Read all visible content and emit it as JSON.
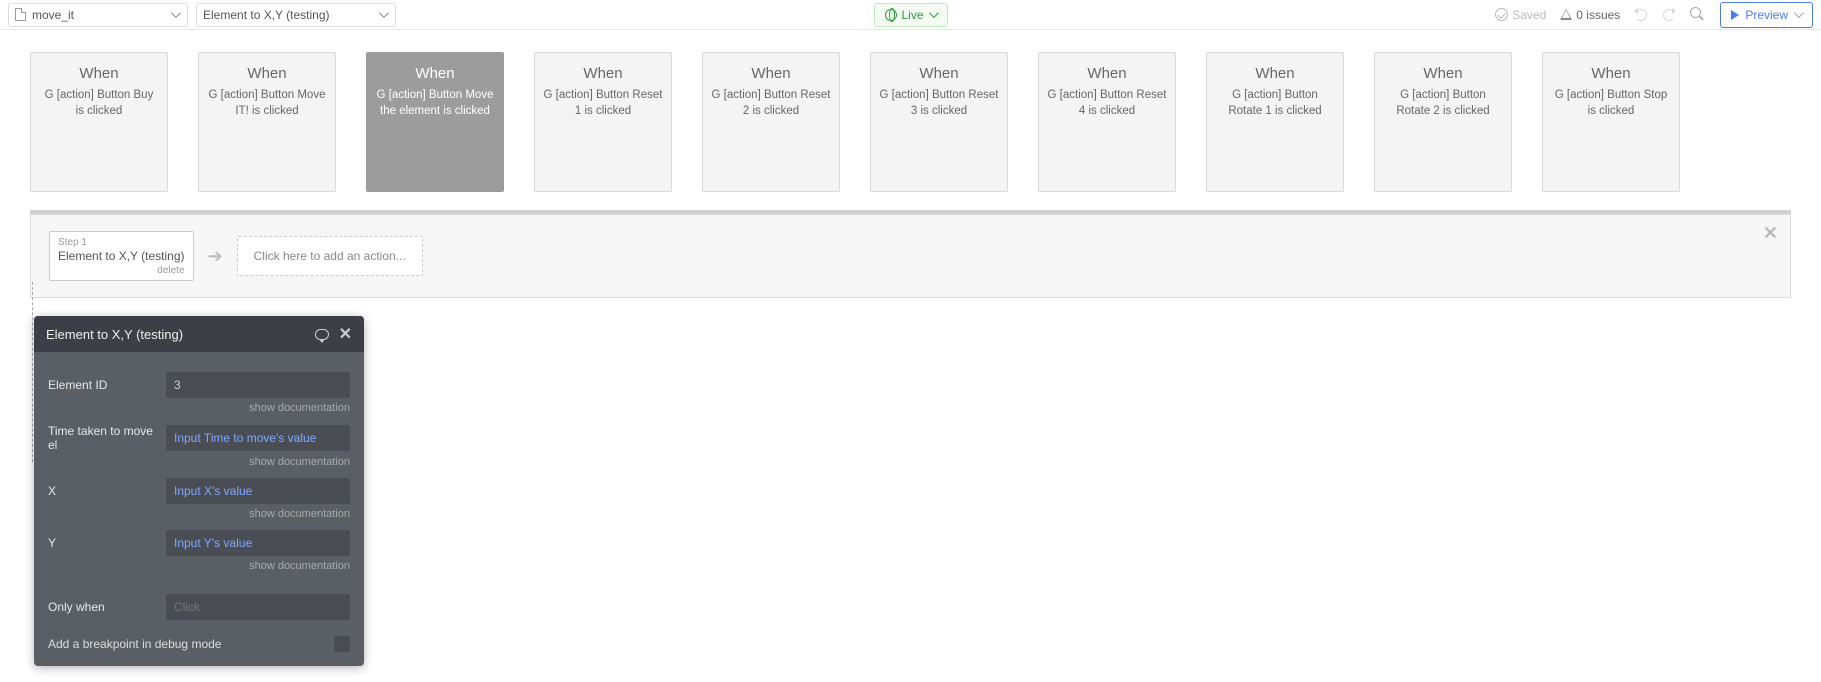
{
  "topbar": {
    "page_name": "move_it",
    "workflow_name": "Element to X,Y (testing)",
    "live_label": "Live",
    "saved_label": "Saved",
    "issues_label": "0 issues",
    "preview_label": "Preview"
  },
  "workflows": [
    {
      "title": "When",
      "sub": "G [action] Button Buy is clicked"
    },
    {
      "title": "When",
      "sub": "G [action] Button Move IT! is clicked"
    },
    {
      "title": "When",
      "sub": "G [action] Button Move the element is clicked",
      "selected": true
    },
    {
      "title": "When",
      "sub": "G [action] Button Reset 1 is clicked"
    },
    {
      "title": "When",
      "sub": "G [action] Button Reset 2 is clicked"
    },
    {
      "title": "When",
      "sub": "G [action] Button Reset 3 is clicked"
    },
    {
      "title": "When",
      "sub": "G [action] Button Reset 4 is clicked"
    },
    {
      "title": "When",
      "sub": "G [action] Button Rotate 1 is clicked"
    },
    {
      "title": "When",
      "sub": "G [action] Button Rotate 2 is clicked"
    },
    {
      "title": "When",
      "sub": "G [action] Button Stop is clicked"
    }
  ],
  "step_panel": {
    "step_num": "Step 1",
    "step_name": "Element to X,Y (testing)",
    "delete_label": "delete",
    "add_action_label": "Click here to add an action..."
  },
  "prop_panel": {
    "title": "Element to X,Y (testing)",
    "rows": {
      "element_id": {
        "label": "Element ID",
        "value": "3"
      },
      "time": {
        "label": "Time taken to move el",
        "value": "Input Time to move's value"
      },
      "x": {
        "label": "X",
        "value": "Input X's value"
      },
      "y": {
        "label": "Y",
        "value": "Input Y's value"
      }
    },
    "doc_label": "show documentation",
    "only_when_label": "Only when",
    "only_when_placeholder": "Click",
    "breakpoint_label": "Add a breakpoint in debug mode"
  }
}
